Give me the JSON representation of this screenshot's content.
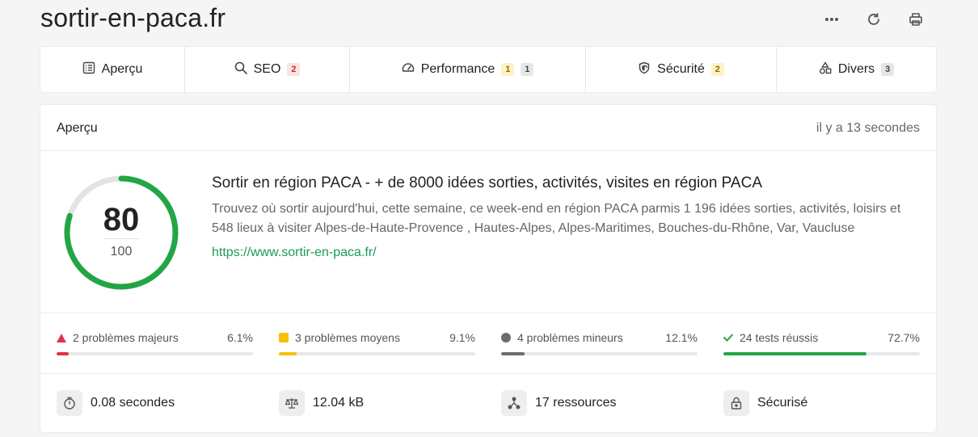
{
  "site_title": "sortir-en-paca.fr",
  "top_actions": [
    "more-icon",
    "refresh-icon",
    "print-icon"
  ],
  "tabs": [
    {
      "label": "Aperçu",
      "icon": "overview-icon",
      "badges": []
    },
    {
      "label": "SEO",
      "icon": "search-icon",
      "badges": [
        {
          "value": "2",
          "kind": "red"
        }
      ]
    },
    {
      "label": "Performance",
      "icon": "gauge-icon",
      "badges": [
        {
          "value": "1",
          "kind": "yellow"
        },
        {
          "value": "1",
          "kind": "gray"
        }
      ]
    },
    {
      "label": "Sécurité",
      "icon": "shield-icon",
      "badges": [
        {
          "value": "2",
          "kind": "yellow"
        }
      ]
    },
    {
      "label": "Divers",
      "icon": "shapes-icon",
      "badges": [
        {
          "value": "3",
          "kind": "gray"
        }
      ]
    }
  ],
  "card": {
    "label": "Aperçu",
    "time": "il y a 13 secondes"
  },
  "score": {
    "value": "80",
    "max": "100",
    "fraction": 0.8,
    "color": "#22a645"
  },
  "page_info": {
    "title": "Sortir en région PACA - + de 8000 idées sorties, activités, visites en région PACA",
    "description": "Trouvez où sortir aujourd'hui, cette semaine, ce week-end en région PACA parmis 1 196 idées sorties, activités, loisirs et 548 lieux à visiter Alpes-de-Haute-Provence , Hautes-Alpes, Alpes-Maritimes, Bouches-du-Rhône, Var, Vaucluse",
    "url": "https://www.sortir-en-paca.fr/"
  },
  "stats": [
    {
      "label": "2 problèmes majeurs",
      "percent": "6.1%",
      "fraction": 0.061,
      "color": "#dc3545",
      "icon": "triangle-icon"
    },
    {
      "label": "3 problèmes moyens",
      "percent": "9.1%",
      "fraction": 0.091,
      "color": "#f5c000",
      "icon": "square-icon"
    },
    {
      "label": "4 problèmes mineurs",
      "percent": "12.1%",
      "fraction": 0.121,
      "color": "#6c6c6c",
      "icon": "circle-icon"
    },
    {
      "label": "24 tests réussis",
      "percent": "72.7%",
      "fraction": 0.727,
      "color": "#22a645",
      "icon": "check-icon"
    }
  ],
  "metrics": [
    {
      "value": "0.08 secondes",
      "icon": "stopwatch-icon"
    },
    {
      "value": "12.04 kB",
      "icon": "scale-icon"
    },
    {
      "value": "17 ressources",
      "icon": "network-icon"
    },
    {
      "value": "Sécurisé",
      "icon": "lock-icon"
    }
  ]
}
